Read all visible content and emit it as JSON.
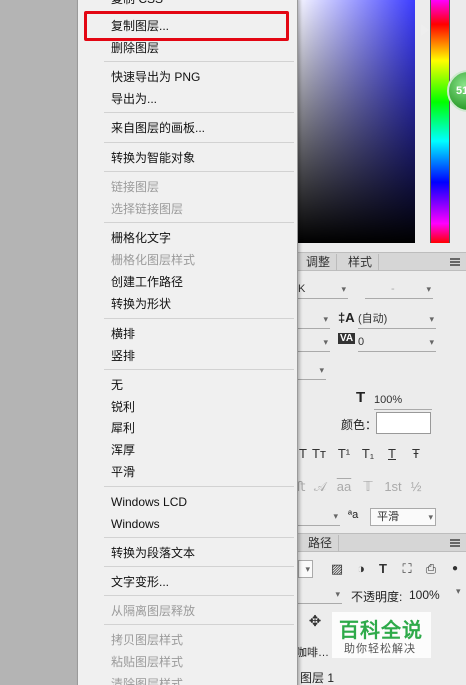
{
  "context_menu": {
    "items": [
      {
        "label": "复制 CSS",
        "disabled": false
      },
      {
        "label": "复制图层...",
        "disabled": false
      },
      {
        "label": "删除图层",
        "disabled": false
      },
      {
        "label": "快速导出为 PNG",
        "disabled": false
      },
      {
        "label": "导出为...",
        "disabled": false
      },
      {
        "label": "来自图层的画板...",
        "disabled": false
      },
      {
        "label": "转换为智能对象",
        "disabled": false
      },
      {
        "label": "链接图层",
        "disabled": true
      },
      {
        "label": "选择链接图层",
        "disabled": true
      },
      {
        "label": "栅格化文字",
        "disabled": false
      },
      {
        "label": "栅格化图层样式",
        "disabled": true
      },
      {
        "label": "创建工作路径",
        "disabled": false
      },
      {
        "label": "转换为形状",
        "disabled": false
      },
      {
        "label": "横排",
        "disabled": false
      },
      {
        "label": "竖排",
        "disabled": false
      },
      {
        "label": "无",
        "disabled": false
      },
      {
        "label": "锐利",
        "disabled": false
      },
      {
        "label": "犀利",
        "disabled": false
      },
      {
        "label": "浑厚",
        "disabled": false
      },
      {
        "label": "平滑",
        "disabled": false
      },
      {
        "label": "Windows LCD",
        "disabled": false
      },
      {
        "label": "Windows",
        "disabled": false
      },
      {
        "label": "转换为段落文本",
        "disabled": false
      },
      {
        "label": "文字变形...",
        "disabled": false
      },
      {
        "label": "从隔离图层释放",
        "disabled": true
      },
      {
        "label": "拷贝图层样式",
        "disabled": true
      },
      {
        "label": "粘贴图层样式",
        "disabled": true
      },
      {
        "label": "清除图层样式",
        "disabled": true
      }
    ],
    "highlighted": "复制图层..."
  },
  "color_picker": {
    "badge_value": "51",
    "accent_color": "#e30613"
  },
  "adjust_tabs": {
    "tab1": "调整",
    "tab2": "样式"
  },
  "character_panel": {
    "font_style": "K",
    "font_style_2": "-",
    "leading": "(自动)",
    "tracking": "0",
    "scale": "100%",
    "color_label": "颜色：",
    "glyphs_row1": [
      "T",
      "Tт",
      "T¹",
      "T₁",
      "T",
      "Ŧ"
    ],
    "glyphs_row2": [
      "ﬅ",
      "𝒜",
      "aa",
      "𝕋",
      "1st",
      "½"
    ],
    "aa_label": "ªa",
    "antialias": "平滑"
  },
  "layers_panel": {
    "tab": "路径",
    "opacity_label": "不透明度:",
    "opacity_value": "100%",
    "layer_partial": "咖啡…",
    "layer_name": "图层 1"
  },
  "watermark": {
    "title": "百科全说",
    "subtitle": "助你轻松解决"
  }
}
